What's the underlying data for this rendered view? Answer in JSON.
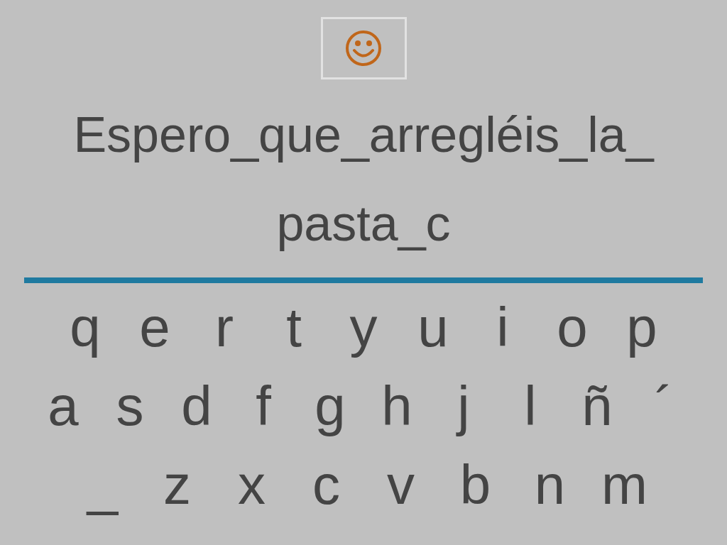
{
  "sentence_lines": [
    "Espero_que_arregléis_la_",
    "pasta_c"
  ],
  "keyboard_rows": [
    [
      "q",
      "e",
      "r",
      "t",
      "y",
      "u",
      "i",
      "o",
      "p"
    ],
    [
      "a",
      "s",
      "d",
      "f",
      "g",
      "h",
      "j",
      "l",
      "ñ",
      "´"
    ],
    [
      "_",
      "z",
      "x",
      "c",
      "v",
      "b",
      "n",
      "m"
    ]
  ]
}
